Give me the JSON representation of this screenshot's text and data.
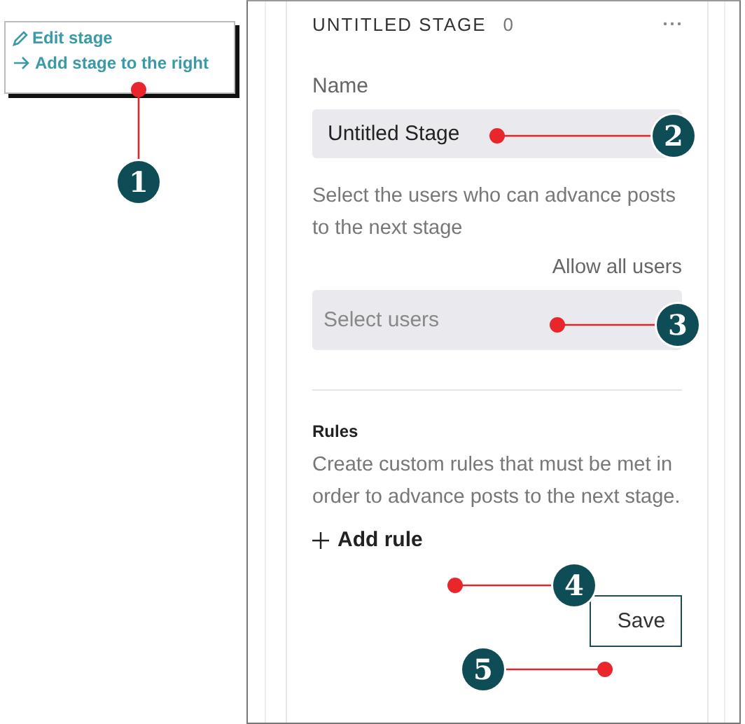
{
  "context_menu": {
    "items": [
      {
        "kind": "edit",
        "label": "Edit stage"
      },
      {
        "kind": "add-right",
        "label": "Add stage to the right"
      }
    ]
  },
  "stage": {
    "title": "UNTITLED STAGE",
    "count": "0",
    "name_label": "Name",
    "name_value": "Untitled Stage",
    "users_hint": "Select the users who can advance posts to the next stage",
    "allow_all": "Allow all users",
    "users_placeholder": "Select users",
    "rules_title": "Rules",
    "rules_hint": "Create custom rules that must be met in order to advance posts to the next stage.",
    "add_rule": "Add rule",
    "save": "Save"
  },
  "callouts": [
    "1",
    "2",
    "3",
    "4",
    "5"
  ]
}
